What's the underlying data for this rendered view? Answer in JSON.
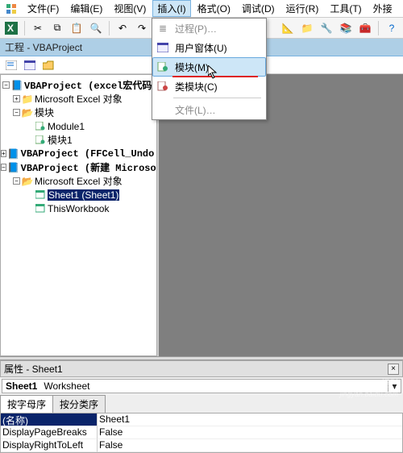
{
  "menu": {
    "items": [
      "文件(F)",
      "编辑(E)",
      "视图(V)",
      "插入(I)",
      "格式(O)",
      "调试(D)",
      "运行(R)",
      "工具(T)",
      "外接"
    ]
  },
  "dropdown": {
    "proc": "过程(P)…",
    "userform": "用户窗体(U)",
    "module": "模块(M)",
    "classmodule": "类模块(C)",
    "file": "文件(L)…"
  },
  "title": "工程 - VBAProject",
  "tree": {
    "p1": "VBAProject (excel宏代码",
    "p1_objs": "Microsoft Excel 对象",
    "p1_modules": "模块",
    "p1_module1": "Module1",
    "p1_module2": "模块1",
    "p2": "VBAProject (FFCell_Undo.xlam)",
    "p3": "VBAProject (新建 Microsoft Excel 工",
    "p3_objs": "Microsoft Excel 对象",
    "p3_sheet1": "Sheet1 (Sheet1)",
    "p3_thiswb": "ThisWorkbook"
  },
  "properties": {
    "title": "属性 - Sheet1",
    "combo_name": "Sheet1",
    "combo_type": "Worksheet",
    "tab_alpha": "按字母序",
    "tab_cat": "按分类序",
    "rows": {
      "name_key": "(名称)",
      "name_val": "Sheet1",
      "dpb_key": "DisplayPageBreaks",
      "dpb_val": "False",
      "drtl_key": "DisplayRightToLeft",
      "drtl_val": "False"
    }
  },
  "watermark": {
    "brand": "Baidu 经验",
    "url": "jingyan.baidu.com"
  }
}
